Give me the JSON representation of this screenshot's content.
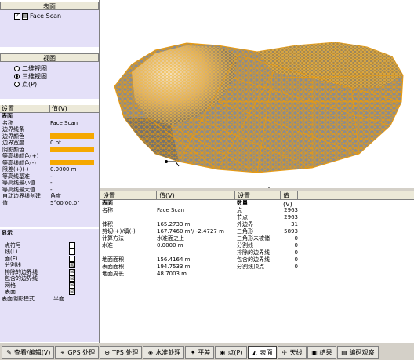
{
  "surface_panel": {
    "title": "表面",
    "item": "Face Scan"
  },
  "view_panel": {
    "title": "视图",
    "options": [
      {
        "label": "二维视图",
        "selected": false
      },
      {
        "label": "三维视图",
        "selected": true
      },
      {
        "label": "点(P)",
        "selected": false
      }
    ]
  },
  "properties": {
    "col_setting": "设置",
    "col_value": "值(V)",
    "section": "表面",
    "rows": [
      {
        "k": "名称",
        "v": "Face Scan"
      },
      {
        "k": "边界线条",
        "v": ""
      },
      {
        "k": "边界颜色",
        "v": "",
        "color": "#f5a800"
      },
      {
        "k": "边界宽度",
        "v": "0 pt"
      },
      {
        "k": "阴影颜色",
        "v": "",
        "color": "#f5a800"
      },
      {
        "k": "等高线颜色(+)",
        "v": ""
      },
      {
        "k": "等高线颜色(-)",
        "v": "",
        "color": "#f5a800"
      },
      {
        "k": "限差(+)(-)",
        "v": "0.0000 m"
      },
      {
        "k": "等高线基准",
        "v": "-"
      },
      {
        "k": "等高线最小值",
        "v": "-"
      },
      {
        "k": "等高线最大值",
        "v": "-"
      },
      {
        "k": "自动边界线创建",
        "v": "角度"
      },
      {
        "k": "值",
        "v": "5°00'00.0\""
      }
    ]
  },
  "display_panel": {
    "title": "显示",
    "rows": [
      {
        "k": "点符号",
        "checked": false
      },
      {
        "k": "线(L)",
        "checked": false
      },
      {
        "k": "面(F)",
        "checked": false
      },
      {
        "k": "分割线",
        "checked": true
      },
      {
        "k": "排除的边界线",
        "checked": true
      },
      {
        "k": "包含的边界线",
        "checked": true
      },
      {
        "k": "网格",
        "checked": true
      },
      {
        "k": "表面",
        "checked": true
      }
    ],
    "shadow_label": "表面阴影模式",
    "shadow_value": "平面"
  },
  "bottom_left": {
    "col_setting": "设置",
    "col_value": "值(V)",
    "section": "表面",
    "rows": [
      {
        "k": "名称",
        "v": "Face Scan"
      },
      {
        "k": "",
        "v": ""
      },
      {
        "k": "体积",
        "v": "165.2733 m"
      },
      {
        "k": "剪切(+)/填(-)",
        "v": "167.7460 m³/ -2.4727 m"
      },
      {
        "k": "计算方法",
        "v": "水准面之上"
      },
      {
        "k": "水准",
        "v": "0.0000 m"
      },
      {
        "k": "",
        "v": ""
      },
      {
        "k": "地面面积",
        "v": "156.4164 m"
      },
      {
        "k": "表面面积",
        "v": "194.7533 m"
      },
      {
        "k": "地面周长",
        "v": "48.7003 m"
      }
    ]
  },
  "bottom_right": {
    "col_setting": "设置",
    "col_value": "值(V)",
    "section": "数量",
    "rows": [
      {
        "k": "点",
        "v": "2963"
      },
      {
        "k": "节点",
        "v": "2963"
      },
      {
        "k": "外边界",
        "v": "31"
      },
      {
        "k": "三角形",
        "v": "5893"
      },
      {
        "k": "三角形未被储",
        "v": "0"
      },
      {
        "k": "分割线",
        "v": "0"
      },
      {
        "k": "排除的边界线",
        "v": "0"
      },
      {
        "k": "包含的边界线",
        "v": "0"
      },
      {
        "k": "分割线顶点",
        "v": "0"
      }
    ]
  },
  "taskbar": [
    {
      "icon": "edit-icon",
      "glyph": "✎",
      "label": "查看/编辑(V)",
      "active": false
    },
    {
      "icon": "gps-icon",
      "glyph": "⌖",
      "label": "GPS 处理",
      "active": false
    },
    {
      "icon": "tps-icon",
      "glyph": "⊕",
      "label": "TPS 处理",
      "active": false
    },
    {
      "icon": "level-icon",
      "glyph": "◈",
      "label": "水准处理",
      "active": false
    },
    {
      "icon": "adjust-icon",
      "glyph": "✦",
      "label": "平差",
      "active": false
    },
    {
      "icon": "point-icon",
      "glyph": "◉",
      "label": "点(P)",
      "active": false
    },
    {
      "icon": "surface-icon",
      "glyph": "◭",
      "label": "表面",
      "active": true
    },
    {
      "icon": "sky-icon",
      "glyph": "✈",
      "label": "天线",
      "active": false
    },
    {
      "icon": "result-icon",
      "glyph": "▣",
      "label": "结果",
      "active": false
    },
    {
      "icon": "report-icon",
      "glyph": "▤",
      "label": "编码观察",
      "active": false
    }
  ],
  "colors": {
    "mesh": "#e89a10",
    "panel": "#e4e0f8",
    "highlight": "#f5a800"
  }
}
